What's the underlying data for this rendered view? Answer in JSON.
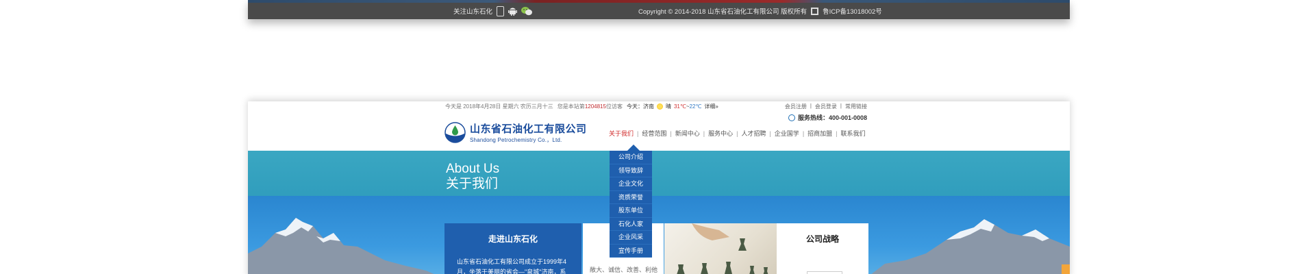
{
  "footer": {
    "follow_label": "关注山东石化",
    "copyright": "Copyright © 2014-2018   山东省石油化工有限公司 版权所有",
    "icp": "鲁ICP备13018002号",
    "icons": [
      "phone-icon",
      "android-icon",
      "wechat-icon",
      "beian-icon"
    ]
  },
  "header": {
    "date": "今天是 2018年4月28日 星期六 农历三月十三",
    "visits_prefix": "您是本站第",
    "visits_count": "1204815",
    "visits_suffix": "位访客",
    "weather_city": "今天：济南",
    "weather_desc": "晴",
    "temp_high": "31℃",
    "temp_sep": "~",
    "temp_low": "22℃",
    "weather_more": "详细»",
    "toplinks": [
      "会员注册",
      "|",
      "会员登录",
      "|",
      "常用链接"
    ],
    "hotline": "服务热线：400-001-0008"
  },
  "logo": {
    "cn": "山东省石油化工有限公司",
    "en": "Shandong Petrochemistry Co.，Ltd."
  },
  "nav": {
    "items": [
      "关于我们",
      "经营范围",
      "新闻中心",
      "服务中心",
      "人才招聘",
      "企业国学",
      "招商加盟",
      "联系我们"
    ],
    "active_index": 0
  },
  "banner": {
    "title_en": "About Us",
    "title_cn": "关于我们"
  },
  "dropdown": {
    "items": [
      "公司介绍",
      "领导致辞",
      "企业文化",
      "资质荣誉",
      "股东单位",
      "石化人家",
      "企业风采",
      "宣传手册"
    ]
  },
  "intro": {
    "title": "走进山东石化",
    "text": "山东省石油化工有限公司成立于1999年4月，坐落于美丽的省会—\"泉城\"济南，系",
    "side_text": "敞大、诚信、改善、利他"
  },
  "strategy": {
    "title": "公司战略"
  },
  "colors": {
    "brand_blue": "#1f5fae",
    "active_red": "#d02a2a",
    "footer_gray": "#4a4a4a",
    "accent_orange": "#f3a53a"
  }
}
